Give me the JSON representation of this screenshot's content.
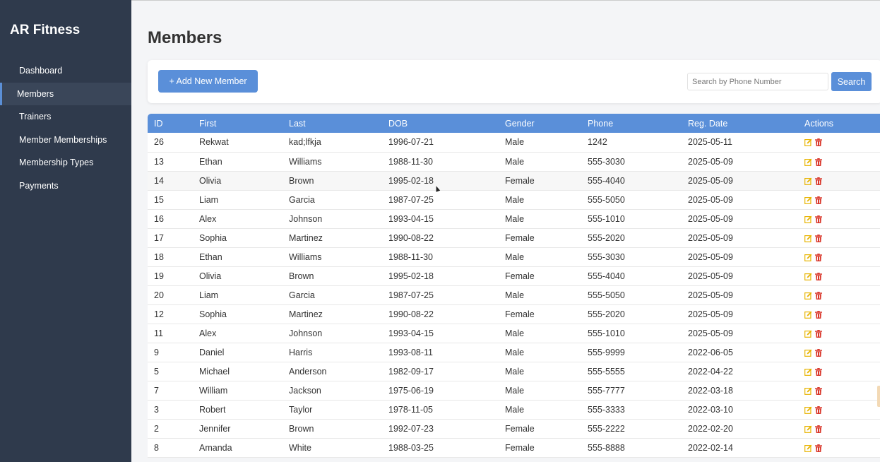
{
  "app": {
    "brand": "AR Fitness"
  },
  "sidebar": {
    "items": [
      {
        "label": "Dashboard",
        "active": false
      },
      {
        "label": "Members",
        "active": true
      },
      {
        "label": "Trainers",
        "active": false
      },
      {
        "label": "Member Memberships",
        "active": false
      },
      {
        "label": "Membership Types",
        "active": false
      },
      {
        "label": "Payments",
        "active": false
      }
    ]
  },
  "page": {
    "title": "Members"
  },
  "toolbar": {
    "add_label": "+ Add New Member",
    "search_placeholder": "Search by Phone Number",
    "search_value": "",
    "search_label": "Search"
  },
  "table": {
    "headers": [
      "ID",
      "First",
      "Last",
      "DOB",
      "Gender",
      "Phone",
      "Reg. Date",
      "Actions"
    ],
    "rows": [
      [
        "26",
        "Rekwat",
        "kad;lfkja",
        "1996-07-21",
        "Male",
        "1242",
        "2025-05-11"
      ],
      [
        "13",
        "Ethan",
        "Williams",
        "1988-11-30",
        "Male",
        "555-3030",
        "2025-05-09"
      ],
      [
        "14",
        "Olivia",
        "Brown",
        "1995-02-18",
        "Female",
        "555-4040",
        "2025-05-09"
      ],
      [
        "15",
        "Liam",
        "Garcia",
        "1987-07-25",
        "Male",
        "555-5050",
        "2025-05-09"
      ],
      [
        "16",
        "Alex",
        "Johnson",
        "1993-04-15",
        "Male",
        "555-1010",
        "2025-05-09"
      ],
      [
        "17",
        "Sophia",
        "Martinez",
        "1990-08-22",
        "Female",
        "555-2020",
        "2025-05-09"
      ],
      [
        "18",
        "Ethan",
        "Williams",
        "1988-11-30",
        "Male",
        "555-3030",
        "2025-05-09"
      ],
      [
        "19",
        "Olivia",
        "Brown",
        "1995-02-18",
        "Female",
        "555-4040",
        "2025-05-09"
      ],
      [
        "20",
        "Liam",
        "Garcia",
        "1987-07-25",
        "Male",
        "555-5050",
        "2025-05-09"
      ],
      [
        "12",
        "Sophia",
        "Martinez",
        "1990-08-22",
        "Female",
        "555-2020",
        "2025-05-09"
      ],
      [
        "11",
        "Alex",
        "Johnson",
        "1993-04-15",
        "Male",
        "555-1010",
        "2025-05-09"
      ],
      [
        "9",
        "Daniel",
        "Harris",
        "1993-08-11",
        "Male",
        "555-9999",
        "2022-06-05"
      ],
      [
        "5",
        "Michael",
        "Anderson",
        "1982-09-17",
        "Male",
        "555-5555",
        "2022-04-22"
      ],
      [
        "7",
        "William",
        "Jackson",
        "1975-06-19",
        "Male",
        "555-7777",
        "2022-03-18"
      ],
      [
        "3",
        "Robert",
        "Taylor",
        "1978-11-05",
        "Male",
        "555-3333",
        "2022-03-10"
      ],
      [
        "2",
        "Jennifer",
        "Brown",
        "1992-07-23",
        "Female",
        "555-2222",
        "2022-02-20"
      ],
      [
        "8",
        "Amanda",
        "White",
        "1988-03-25",
        "Female",
        "555-8888",
        "2022-02-14"
      ]
    ]
  },
  "icons": {
    "edit": "edit-icon",
    "delete": "trash-icon"
  },
  "colors": {
    "sidebar_bg": "#2f3a4c",
    "accent": "#5a8fd9",
    "edit": "#e8b400",
    "delete": "#d9372b"
  }
}
